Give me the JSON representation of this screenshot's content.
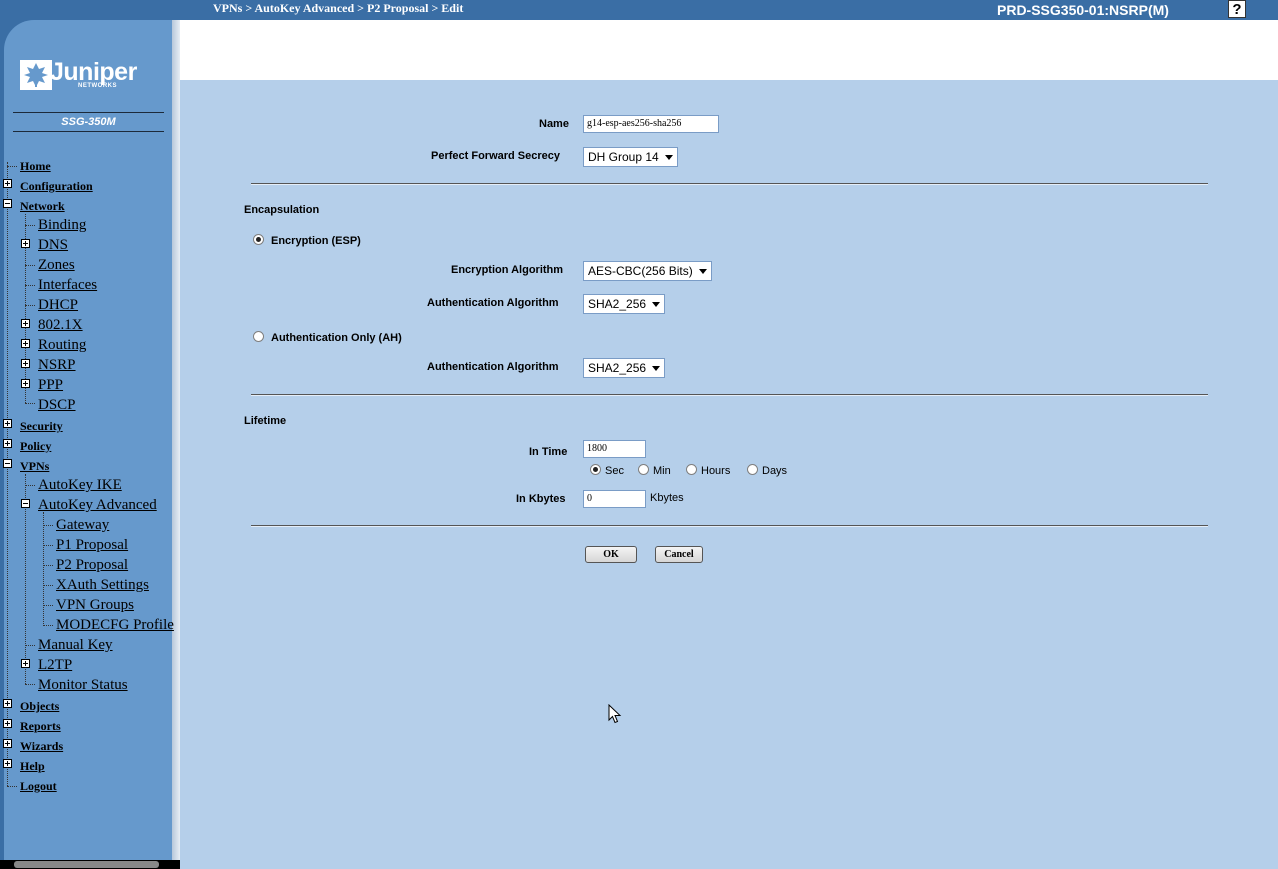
{
  "header": {
    "breadcrumb": "VPNs > AutoKey Advanced > P2 Proposal > Edit",
    "device_name": "PRD-SSG350-01:NSRP(M)",
    "help_label": "?",
    "bar_color": "#3a6ea5"
  },
  "sidebar": {
    "logo_text": "Juniper",
    "logo_sub": "NETWORKS",
    "model": "SSG-350M",
    "background": "#6699cc",
    "items": [
      {
        "label": "Home"
      },
      {
        "label": "Configuration"
      },
      {
        "label": "Network"
      },
      {
        "label": "Binding"
      },
      {
        "label": "DNS"
      },
      {
        "label": "Zones"
      },
      {
        "label": "Interfaces"
      },
      {
        "label": "DHCP"
      },
      {
        "label": "802.1X"
      },
      {
        "label": "Routing"
      },
      {
        "label": "NSRP"
      },
      {
        "label": "PPP"
      },
      {
        "label": "DSCP"
      },
      {
        "label": "Security"
      },
      {
        "label": "Policy"
      },
      {
        "label": "VPNs"
      },
      {
        "label": "AutoKey IKE"
      },
      {
        "label": "AutoKey Advanced"
      },
      {
        "label": "Gateway"
      },
      {
        "label": "P1 Proposal"
      },
      {
        "label": "P2 Proposal"
      },
      {
        "label": "XAuth Settings"
      },
      {
        "label": "VPN Groups"
      },
      {
        "label": "MODECFG Profile"
      },
      {
        "label": "Manual Key"
      },
      {
        "label": "L2TP"
      },
      {
        "label": "Monitor Status"
      },
      {
        "label": "Objects"
      },
      {
        "label": "Reports"
      },
      {
        "label": "Wizards"
      },
      {
        "label": "Help"
      },
      {
        "label": "Logout"
      }
    ]
  },
  "form": {
    "background": "#b5cfea",
    "name_label": "Name",
    "name_value": "g14-esp-aes256-sha256",
    "pfs_label": "Perfect Forward Secrecy",
    "pfs_value": "DH Group 14",
    "encapsulation_title": "Encapsulation",
    "esp_label": "Encryption (ESP)",
    "esp_selected": true,
    "enc_alg_label": "Encryption Algorithm",
    "enc_alg_value": "AES-CBC(256 Bits)",
    "auth_alg_label": "Authentication Algorithm",
    "auth_alg_value": "SHA2_256",
    "ah_label": "Authentication Only (AH)",
    "ah_auth_alg_label": "Authentication Algorithm",
    "ah_auth_alg_value": "SHA2_256",
    "lifetime_title": "Lifetime",
    "in_time_label": "In Time",
    "in_time_value": "1800",
    "time_units": [
      "Sec",
      "Min",
      "Hours",
      "Days"
    ],
    "time_unit_selected": "Sec",
    "in_kbytes_label": "In Kbytes",
    "in_kbytes_value": "0",
    "kbytes_unit": "Kbytes",
    "ok_label": "OK",
    "cancel_label": "Cancel"
  }
}
